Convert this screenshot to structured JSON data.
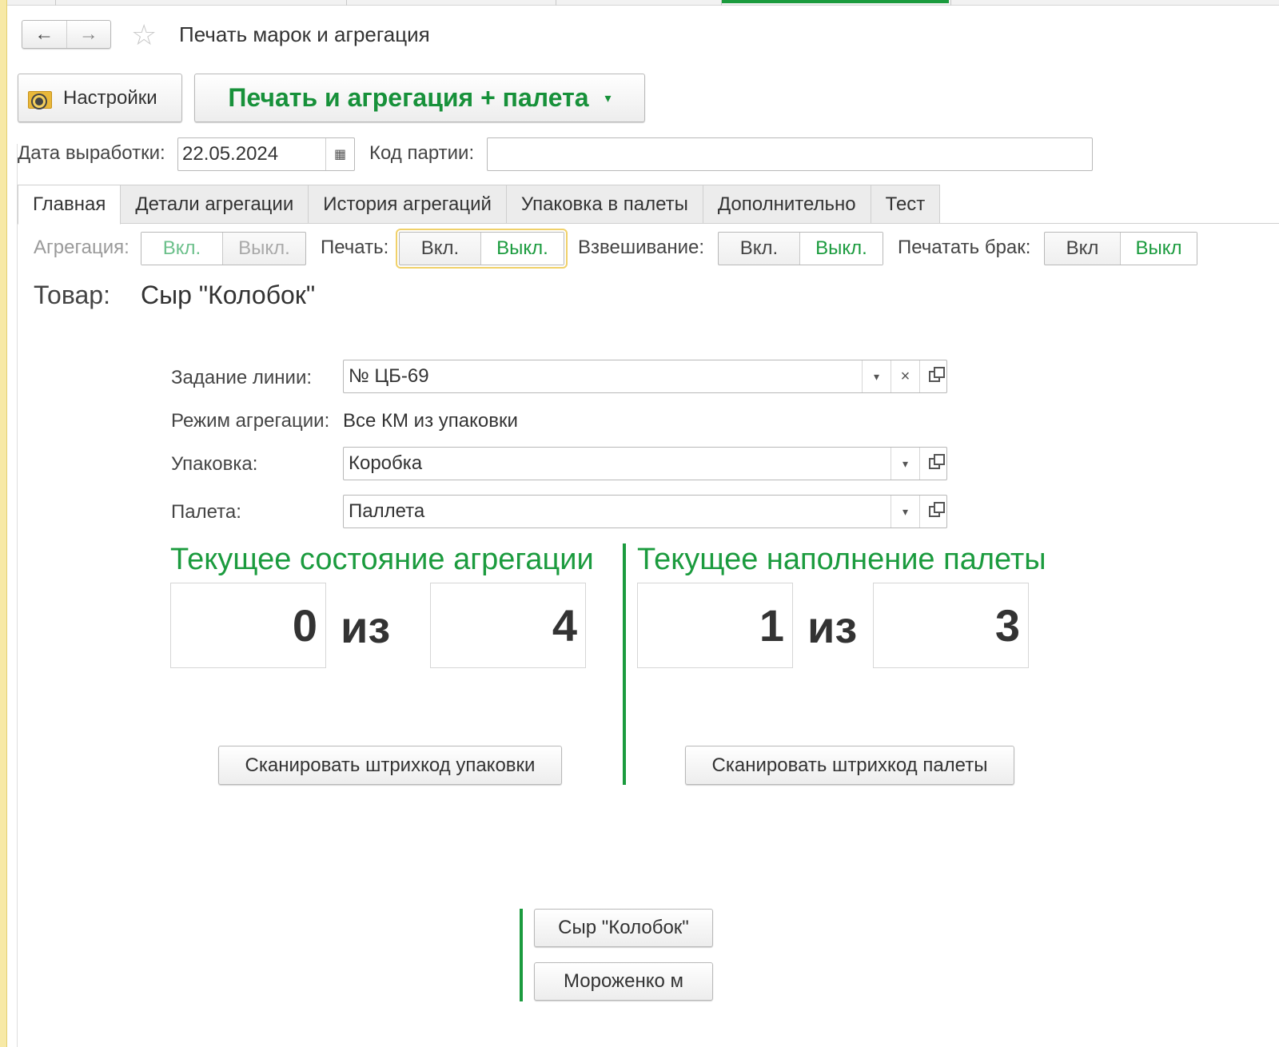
{
  "window": {
    "title": "Печать марок и агрегация",
    "nav": {
      "back_icon": "←",
      "forward_icon": "→",
      "favorite_icon": "☆"
    }
  },
  "toolbar": {
    "settings_label": "Настройки",
    "print_label": "Печать и агрегация + палета",
    "print_caret": "▾"
  },
  "header_fields": {
    "date_label": "Дата выработки:",
    "date_value": "22.05.2024",
    "calendar_icon": "▦",
    "batch_label": "Код партии:",
    "batch_value": ""
  },
  "tabs": [
    {
      "label": "Главная",
      "active": true
    },
    {
      "label": "Детали агрегации",
      "active": false
    },
    {
      "label": "История агрегаций",
      "active": false
    },
    {
      "label": "Упаковка в палеты",
      "active": false
    },
    {
      "label": "Дополнительно",
      "active": false
    },
    {
      "label": "Тест",
      "active": false
    }
  ],
  "toggles": {
    "aggregation": {
      "label": "Агрегация:",
      "on": "Вкл.",
      "off": "Выкл.",
      "selected": "on",
      "enabled": false
    },
    "print": {
      "label": "Печать:",
      "on": "Вкл.",
      "off": "Выкл.",
      "selected": "off",
      "enabled": true
    },
    "weighing": {
      "label": "Взвешивание:",
      "on": "Вкл.",
      "off": "Выкл.",
      "selected": "off",
      "enabled": true
    },
    "print_defect": {
      "label": "Печатать брак:",
      "on": "Вкл",
      "off": "Выкл",
      "selected": "off",
      "enabled": true
    }
  },
  "product": {
    "label": "Товар:",
    "value": "Сыр \"Колобок\""
  },
  "form": {
    "line_task_label": "Задание линии:",
    "line_task_value": "№ ЦБ-69",
    "mode_label": "Режим агрегации:",
    "mode_value": "Все КМ из упаковки",
    "package_label": "Упаковка:",
    "package_value": "Коробка",
    "pallet_label": "Палета:",
    "pallet_value": "Паллета",
    "dropdown_icon": "▾",
    "clear_icon": "×"
  },
  "aggregation_state": {
    "title": "Текущее состояние агрегации",
    "current": "0",
    "of_word": "из",
    "total": "4",
    "scan_label": "Сканировать штрихкод упаковки"
  },
  "pallet_state": {
    "title": "Текущее наполнение палеты",
    "current": "1",
    "of_word": "из",
    "total": "3",
    "scan_label": "Сканировать штрихкод палеты"
  },
  "product_list": [
    {
      "label": "Сыр \"Колобок\""
    },
    {
      "label": "Мороженко м"
    }
  ],
  "colors": {
    "accent_green": "#1b9b3e",
    "text": "#333333",
    "strip_yellow": "#f7e9a6"
  }
}
